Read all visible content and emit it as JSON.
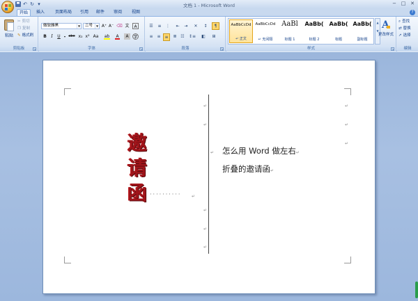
{
  "window": {
    "title": "文档 1 - Microsoft Word",
    "quick_access": [
      "save-icon",
      "undo-icon",
      "redo-icon",
      "customize-icon"
    ],
    "controls": [
      "−",
      "□",
      "✕"
    ]
  },
  "tabs": [
    "开始",
    "插入",
    "页面布局",
    "引用",
    "邮件",
    "审阅",
    "视图"
  ],
  "active_tab": "开始",
  "ribbon": {
    "clipboard": {
      "label": "剪贴板",
      "paste": "粘贴",
      "cut": "剪切",
      "copy": "复制",
      "format_painter": "格式刷"
    },
    "font": {
      "label": "字体",
      "font_name": "微软雅黑",
      "font_size": "二号",
      "bold": "B",
      "italic": "I",
      "underline": "U",
      "strike": "abe",
      "subscript": "x₂",
      "superscript": "x²",
      "change_case": "Aa",
      "grow": "A⁺",
      "shrink": "A⁻",
      "font_color": "A",
      "highlight": "ab",
      "char_border": "A",
      "char_shading": "A"
    },
    "paragraph": {
      "label": "段落"
    },
    "styles": {
      "label": "样式",
      "items": [
        {
          "sample": "AaBbCcDd",
          "name": "↵ 正文",
          "selected": true
        },
        {
          "sample": "AaBbCcDd",
          "name": "↵ 无间隔",
          "selected": false
        },
        {
          "sample": "AaBl",
          "name": "标题 1",
          "selected": false
        },
        {
          "sample": "AaBb(",
          "name": "标题 2",
          "selected": false
        },
        {
          "sample": "AaBb(",
          "name": "标题",
          "selected": false
        },
        {
          "sample": "AaBb(",
          "name": "副标题",
          "selected": false
        }
      ],
      "change_styles": "更改样式"
    },
    "editing": {
      "label": "编辑",
      "find": "查找",
      "replace": "替换",
      "select": "选择"
    }
  },
  "document": {
    "invitation_chars": [
      "邀",
      "请",
      "函"
    ],
    "leader_dots": "··········",
    "line1": "怎么用 Word 做左右",
    "line2": "折叠的邀请函",
    "paragraph_mark": "↵"
  },
  "colors": {
    "invite_red": "#a0141a",
    "ribbon_blue": "#15428b",
    "doc_background": "#9bb6dc"
  }
}
